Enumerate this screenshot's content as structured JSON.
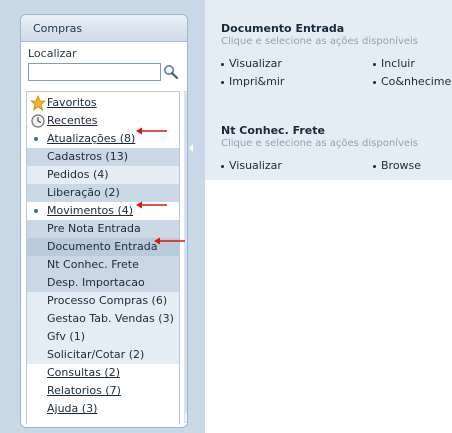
{
  "panel": {
    "title": "Compras",
    "search_label": "Localizar",
    "search_value": ""
  },
  "menu": {
    "favoritos": "Favoritos",
    "recentes": "Recentes",
    "atualizacoes": "Atualizações (8)",
    "cadastros": "Cadastros (13)",
    "pedidos": "Pedidos (4)",
    "liberacao": "Liberação (2)",
    "movimentos": "Movimentos (4)",
    "pre_nota": "Pre Nota Entrada",
    "documento_entrada": "Documento Entrada",
    "nt_conhec": "Nt Conhec. Frete",
    "desp_importacao": "Desp. Importacao",
    "processo_compras": "Processo Compras (6)",
    "gestao_tab": "Gestao Tab. Vendas (3)",
    "gfv": "Gfv (1)",
    "solicitar": "Solicitar/Cotar (2)",
    "consultas": "Consultas (2)",
    "relatorios": "Relatorios (7)",
    "ajuda": "Ajuda (3)"
  },
  "sections": [
    {
      "title": "Documento Entrada",
      "subtitle": "Clique e selecione as ações disponíveis",
      "actions": [
        "Visualizar",
        "Incluir",
        "Impri&mir",
        "Co&nhecimento"
      ]
    },
    {
      "title": "Nt Conhec. Frete",
      "subtitle": "Clique e selecione as ações disponíveis",
      "actions": [
        "Visualizar",
        "Browse"
      ]
    }
  ],
  "colors": {
    "annotation_arrow": "#e0140c",
    "highlight_row": "#cad8e5"
  },
  "icons": {
    "search": "magnifier-icon",
    "favoritos": "star-icon",
    "recentes": "clock-icon"
  }
}
